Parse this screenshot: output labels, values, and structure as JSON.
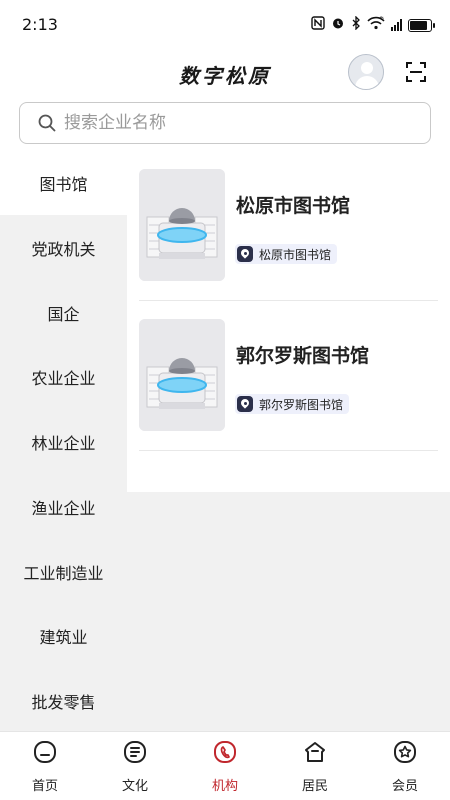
{
  "status_bar": {
    "time": "2:13",
    "icons": [
      "nfc-icon",
      "alarm-icon",
      "bluetooth-icon",
      "wifi-icon",
      "signal-icon",
      "battery-icon"
    ],
    "network": "6",
    "battery_level": 0.9
  },
  "header": {
    "title": "数字松原",
    "avatar_icon": "avatar-icon",
    "scan_icon": "scan-icon"
  },
  "search": {
    "placeholder": "搜索企业名称",
    "value": ""
  },
  "sidebar": {
    "items": [
      {
        "label": "图书馆",
        "active": true
      },
      {
        "label": "党政机关"
      },
      {
        "label": "国企"
      },
      {
        "label": "农业企业"
      },
      {
        "label": "林业企业"
      },
      {
        "label": "渔业企业"
      },
      {
        "label": "工业制造业"
      },
      {
        "label": "建筑业"
      },
      {
        "label": "批发零售"
      }
    ]
  },
  "list": {
    "items": [
      {
        "title": "松原市图书馆",
        "tag": "松原市图书馆",
        "tag_icon": "location-pin-icon"
      },
      {
        "title": "郭尔罗斯图书馆",
        "tag": "郭尔罗斯图书馆",
        "tag_icon": "location-pin-icon"
      }
    ]
  },
  "tabbar": {
    "tabs": [
      {
        "label": "首页",
        "icon": "home-icon"
      },
      {
        "label": "文化",
        "icon": "culture-icon"
      },
      {
        "label": "机构",
        "icon": "institution-icon",
        "active": true
      },
      {
        "label": "居民",
        "icon": "resident-icon"
      },
      {
        "label": "会员",
        "icon": "member-icon"
      }
    ]
  },
  "colors": {
    "accent": "#c0272d",
    "sidebar_bg": "#f1f1f1",
    "tag_bg": "#eef0fb",
    "tag_pin": "#2b2f4a"
  }
}
